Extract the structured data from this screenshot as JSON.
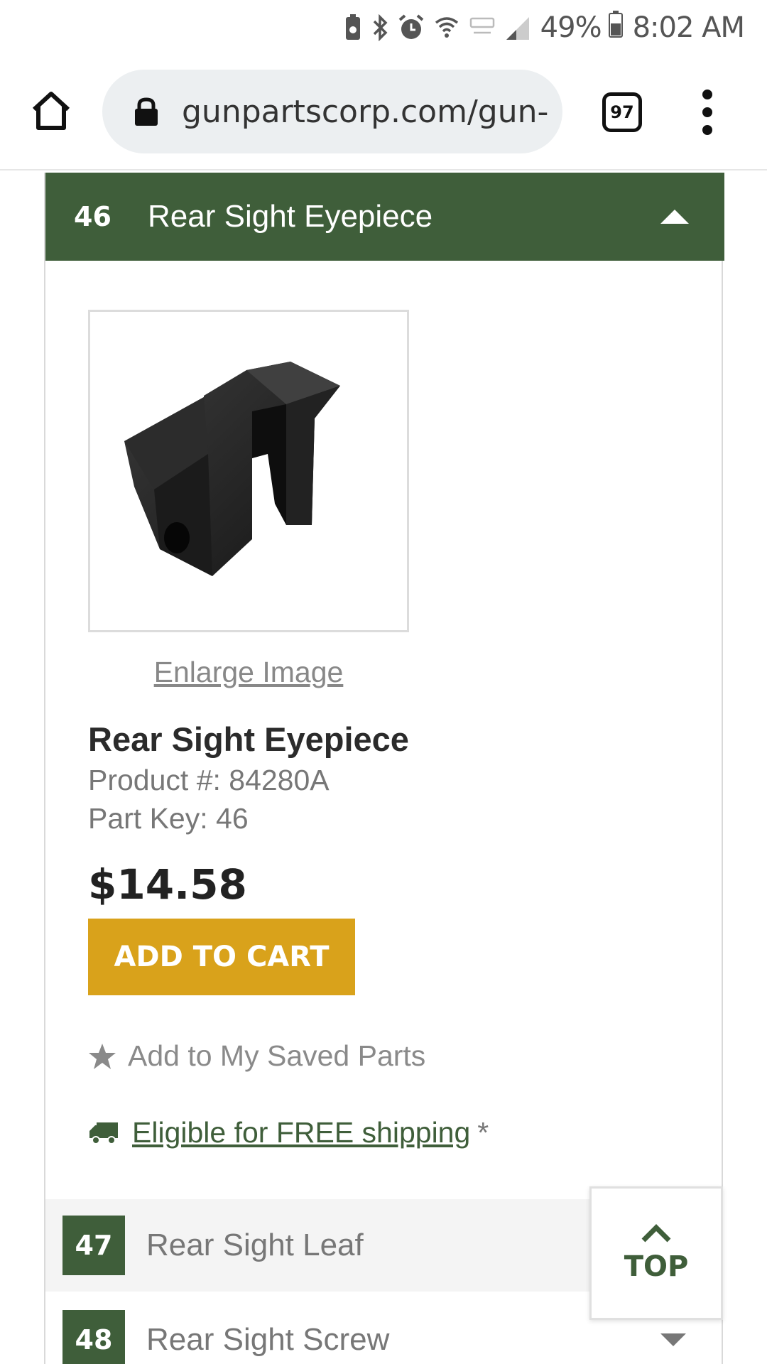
{
  "status_bar": {
    "battery_percent": "49%",
    "time": "8:02 AM",
    "icons": [
      "battery-saver-icon",
      "bluetooth-icon",
      "alarm-icon",
      "wifi-icon",
      "network-icon",
      "signal-icon",
      "battery-icon"
    ]
  },
  "browser": {
    "url": "gunpartscorp.com/gun-parts",
    "tab_count": "97",
    "icons": [
      "home-icon",
      "lock-icon",
      "more-menu-icon"
    ]
  },
  "expanded_part": {
    "key": "46",
    "title": "Rear Sight Eyepiece",
    "enlarge_label": "Enlarge Image",
    "name": "Rear Sight Eyepiece",
    "product_number": "Product #: 84280A",
    "part_key_line": "Part Key: 46",
    "price": "$14.58",
    "add_to_cart_label": "ADD TO CART",
    "saved_parts_label": "Add to My Saved Parts",
    "shipping_label": "Eligible for FREE shipping",
    "shipping_asterisk": "*"
  },
  "parts_list": [
    {
      "key": "47",
      "title": "Rear Sight Leaf"
    },
    {
      "key": "48",
      "title": "Rear Sight Screw"
    }
  ],
  "top_button": {
    "label": "TOP"
  },
  "colors": {
    "header_green": "#3f5e3a",
    "cart_gold": "#d9a21b",
    "muted_text": "#777777"
  }
}
